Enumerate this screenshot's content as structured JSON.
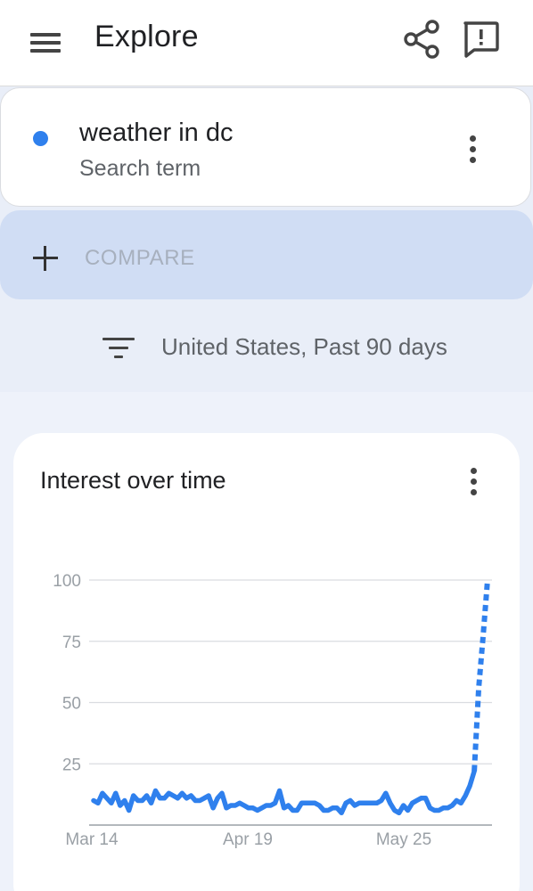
{
  "header": {
    "title": "Explore",
    "menu_icon": "hamburger-menu-icon",
    "share_icon": "share-icon",
    "feedback_icon": "feedback-icon"
  },
  "search_term": {
    "name": "weather in dc",
    "type_label": "Search term",
    "dot_color": "#2f80ed"
  },
  "compare": {
    "label": "COMPARE"
  },
  "filter": {
    "text": "United States, Past 90 days"
  },
  "colors": {
    "accent": "#2f80ed",
    "compare_bg": "#d0ddf4"
  },
  "chart_data": {
    "type": "line",
    "title": "Interest over time",
    "ylim": [
      0,
      100
    ],
    "y_ticks": [
      "100",
      "75",
      "50",
      "25"
    ],
    "x_ticks": [
      "Mar 14",
      "Apr 19",
      "May 25"
    ],
    "grid": true,
    "x_start": "Mar 14",
    "x_end": "Jun 11",
    "series": [
      {
        "values": [
          10,
          9,
          13,
          11,
          9,
          13,
          8,
          10,
          6,
          12,
          10,
          10,
          12,
          9,
          14,
          11,
          11,
          13,
          12,
          11,
          13,
          11,
          12,
          10,
          10,
          11,
          12,
          7,
          11,
          13,
          7,
          8,
          8,
          9,
          8,
          7,
          7,
          6,
          7,
          8,
          8,
          9,
          14,
          7,
          8,
          6,
          6,
          9,
          9,
          9,
          9,
          8,
          6,
          6,
          7,
          7,
          5,
          9,
          10,
          8,
          9,
          9,
          9,
          9,
          9,
          10,
          13,
          9,
          6,
          5,
          8,
          6,
          9,
          10,
          11,
          11,
          7,
          6,
          6,
          7,
          7,
          8,
          10,
          9,
          12,
          16,
          22,
          56,
          77,
          100
        ],
        "partial_from_index": 86
      }
    ]
  }
}
